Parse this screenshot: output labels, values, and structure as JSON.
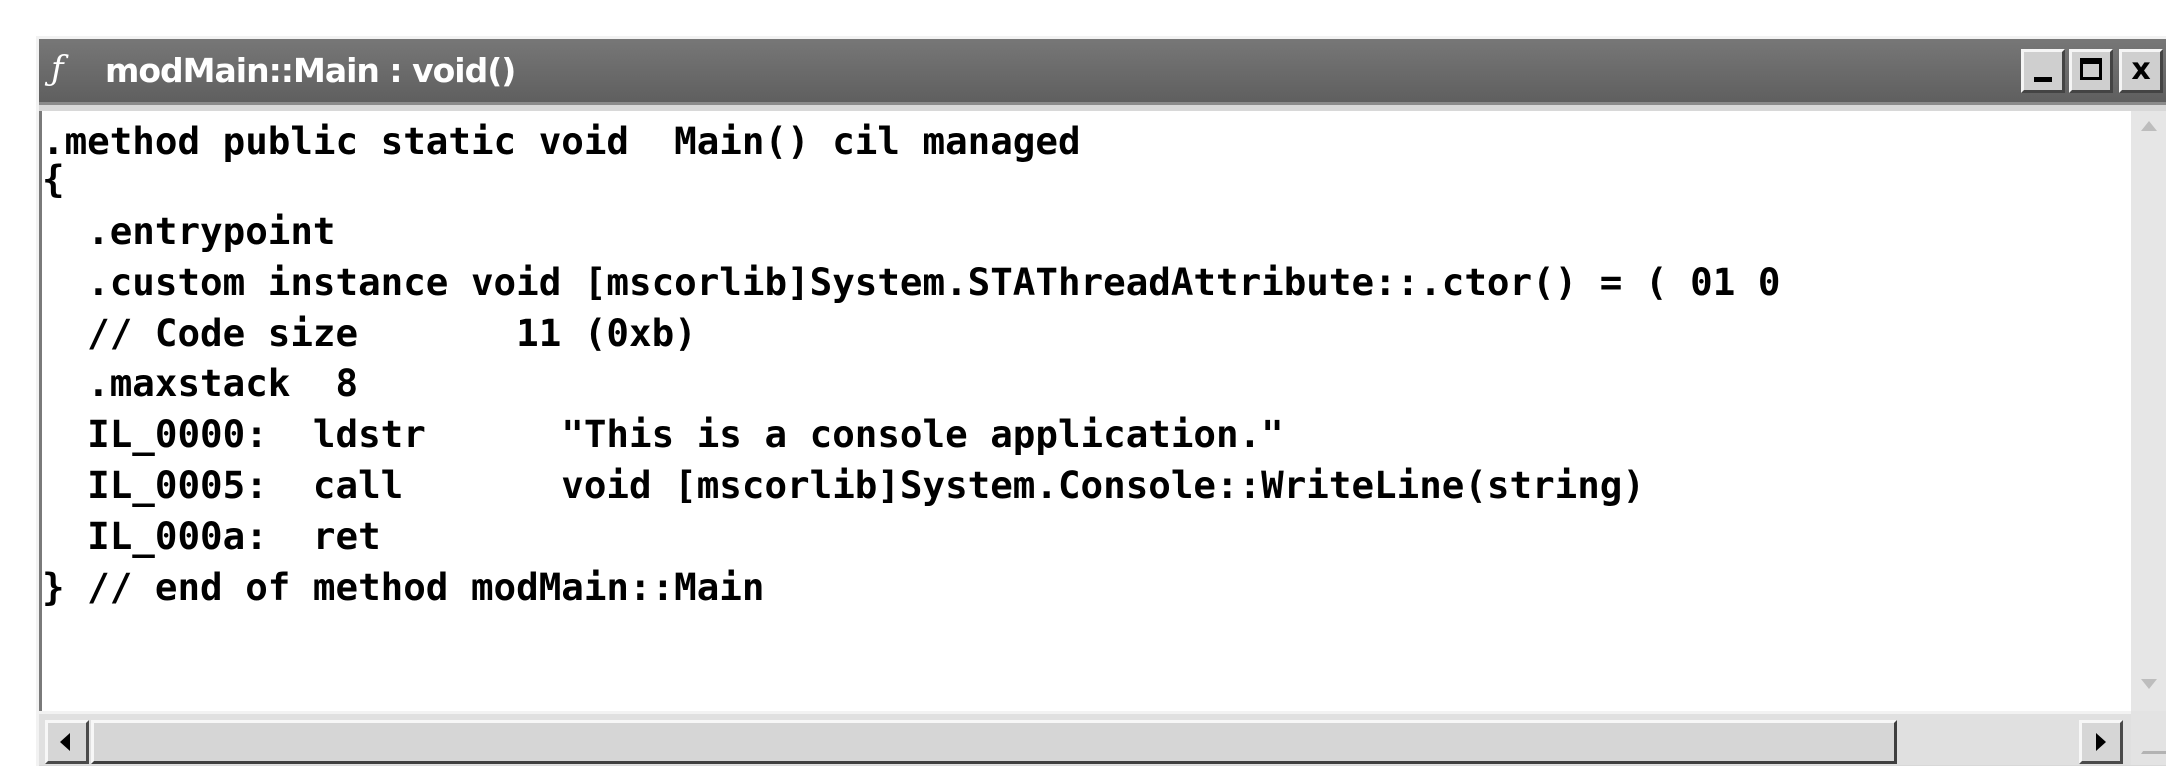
{
  "window": {
    "title": "modMain::Main : void()",
    "title_icon": "quill-icon",
    "buttons": [
      "minimize",
      "maximize",
      "close"
    ],
    "close_label": "x"
  },
  "code": {
    "lines": [
      ".method public static void  Main() cil managed",
      "{",
      "  .entrypoint",
      "  .custom instance void [mscorlib]System.STAThreadAttribute::.ctor() = ( 01 0",
      "  // Code size       11 (0xb)",
      "  .maxstack  8",
      "  IL_0000:  ldstr      \"This is a console application.\"",
      "  IL_0005:  call       void [mscorlib]System.Console::WriteLine(string)",
      "  IL_000a:  ret",
      "} // end of method modMain::Main"
    ]
  },
  "colors": {
    "titlebar": "#6b6b6b",
    "title_text": "#ffffff",
    "code_bg": "#ffffff",
    "chrome": "#d8d8d8"
  }
}
